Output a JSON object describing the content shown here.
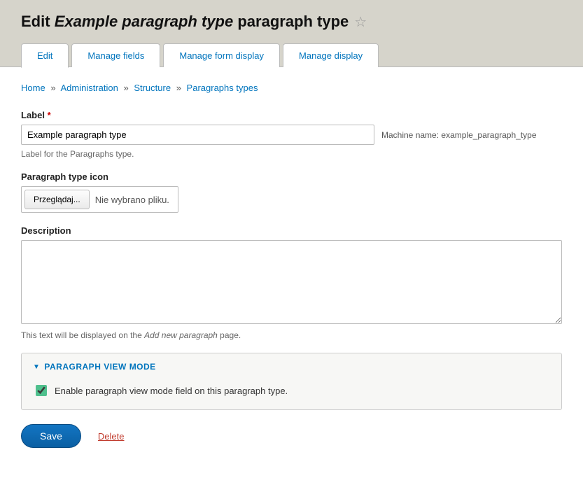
{
  "page": {
    "title_prefix": "Edit",
    "title_italic": "Example paragraph type",
    "title_suffix": "paragraph type"
  },
  "tabs": [
    {
      "label": "Edit",
      "active": true
    },
    {
      "label": "Manage fields",
      "active": false
    },
    {
      "label": "Manage form display",
      "active": false
    },
    {
      "label": "Manage display",
      "active": false
    }
  ],
  "breadcrumbs": [
    {
      "label": "Home"
    },
    {
      "label": "Administration"
    },
    {
      "label": "Structure"
    },
    {
      "label": "Paragraphs types"
    }
  ],
  "form": {
    "label_field": {
      "label": "Label",
      "value": "Example paragraph type",
      "machine_name_label": "Machine name:",
      "machine_name_value": "example_paragraph_type",
      "help": "Label for the Paragraphs type."
    },
    "icon_field": {
      "label": "Paragraph type icon",
      "browse_button": "Przeglądaj...",
      "no_file_text": "Nie wybrano pliku."
    },
    "description_field": {
      "label": "Description",
      "value": "",
      "help_prefix": "This text will be displayed on the ",
      "help_italic": "Add new paragraph",
      "help_suffix": " page."
    },
    "view_mode": {
      "legend": "PARAGRAPH VIEW MODE",
      "checkbox_label": "Enable paragraph view mode field on this paragraph type.",
      "checked": true
    },
    "actions": {
      "save": "Save",
      "delete": "Delete"
    }
  }
}
